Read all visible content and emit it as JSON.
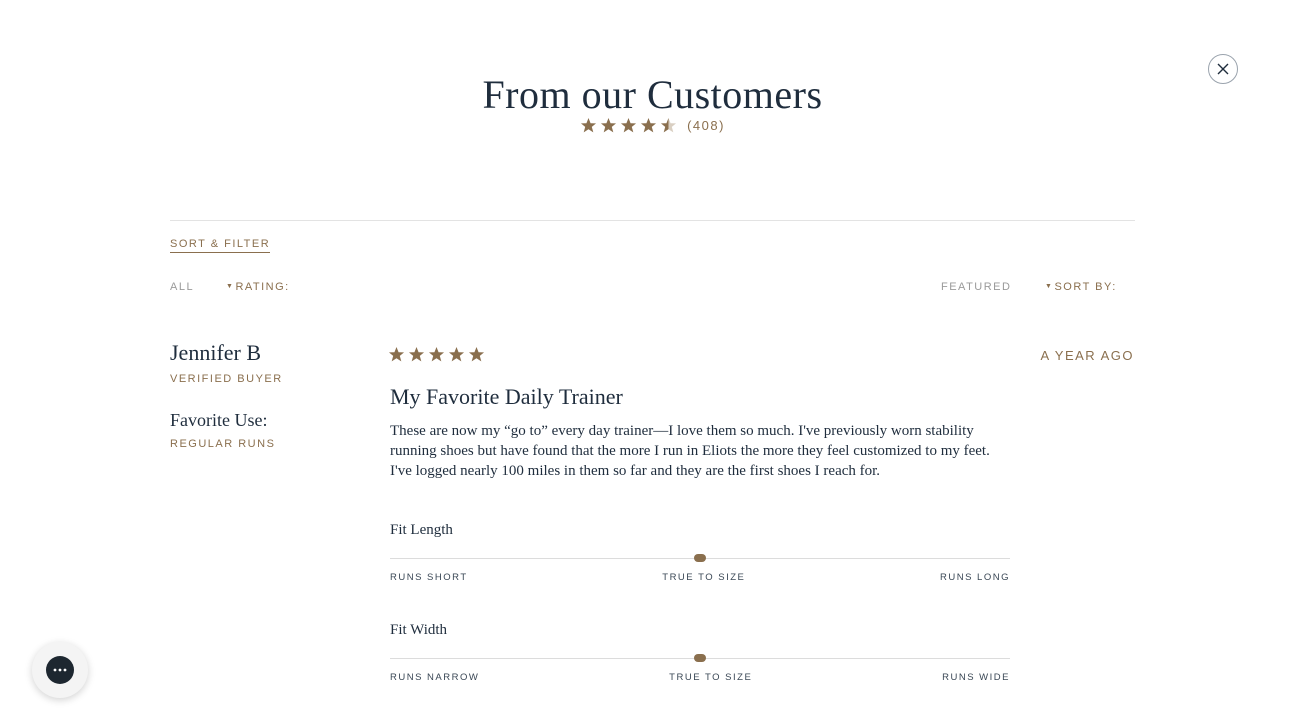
{
  "modal": {
    "title": "From our Customers",
    "rating": 4.5,
    "review_count": "(408)"
  },
  "filters": {
    "sort_filter_label": "SORT & FILTER",
    "rating_value": "ALL",
    "rating_label": "RATING:",
    "sort_value": "FEATURED",
    "sort_label": "SORT BY:"
  },
  "review": {
    "reviewer": "Jennifer B",
    "verified": "VERIFIED BUYER",
    "favorite_use_label": "Favorite Use:",
    "favorite_use_value": "REGULAR RUNS",
    "stars": 5,
    "date": "A YEAR AGO",
    "title": "My Favorite Daily Trainer",
    "body": "These are now my “go to” every day trainer—I love them so much. I've previously worn stability running shoes but have found that the more I run in Eliots the more they feel customized to my feet. I've logged nearly 100 miles in them so far and they are the first shoes I reach for.",
    "fit_length": {
      "title": "Fit Length",
      "value": 0.5,
      "left": "RUNS SHORT",
      "center": "TRUE TO SIZE",
      "right": "RUNS LONG"
    },
    "fit_width": {
      "title": "Fit Width",
      "value": 0.5,
      "left": "RUNS NARROW",
      "center": "TRUE TO SIZE",
      "right": "RUNS WIDE"
    }
  },
  "icons": {
    "close": "close-icon",
    "star": "star-icon",
    "chat": "chat-icon",
    "caret": "chevron-down-icon"
  },
  "colors": {
    "accent": "#8a6f4e",
    "text": "#1f2d3d"
  }
}
